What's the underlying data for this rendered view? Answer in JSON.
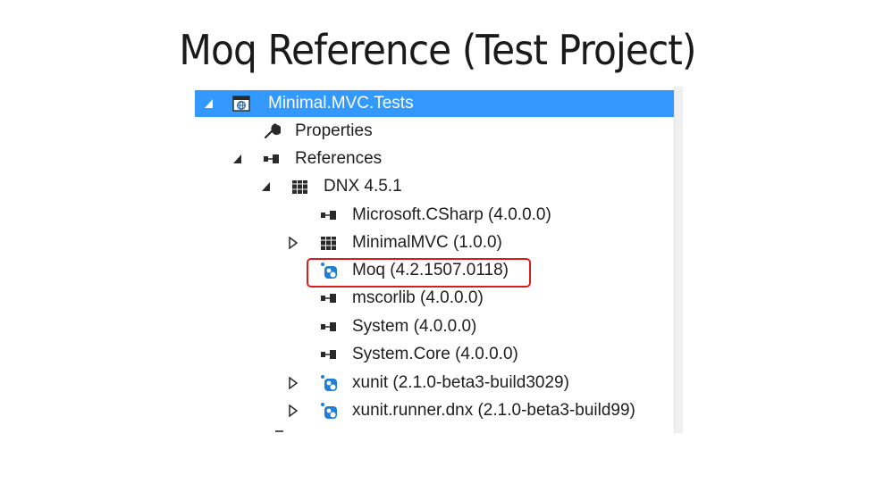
{
  "slide": {
    "title": "Moq Reference (Test Project)"
  },
  "tree": {
    "project": {
      "label": "Minimal.MVC.Tests",
      "expanded": true,
      "selected": true
    },
    "properties": {
      "label": "Properties"
    },
    "references": {
      "label": "References",
      "expanded": true
    },
    "framework": {
      "label": "DNX 4.5.1",
      "expanded": true
    },
    "items": [
      {
        "label": "Microsoft.CSharp (4.0.0.0)",
        "icon": "assembly-reference-icon",
        "expandable": false
      },
      {
        "label": "MinimalMVC (1.0.0)",
        "icon": "project-reference-icon",
        "expandable": true
      },
      {
        "label": "Moq (4.2.1507.0118)",
        "icon": "nuget-package-icon",
        "expandable": false,
        "highlighted": true
      },
      {
        "label": "mscorlib (4.0.0.0)",
        "icon": "assembly-reference-icon",
        "expandable": false
      },
      {
        "label": "System (4.0.0.0)",
        "icon": "assembly-reference-icon",
        "expandable": false
      },
      {
        "label": "System.Core (4.0.0.0)",
        "icon": "assembly-reference-icon",
        "expandable": false
      },
      {
        "label": "xunit (2.1.0-beta3-build3029)",
        "icon": "nuget-package-icon",
        "expandable": true
      },
      {
        "label": "xunit.runner.dnx (2.1.0-beta3-build99)",
        "icon": "nuget-package-icon",
        "expandable": true
      }
    ]
  },
  "colors": {
    "selection": "#3399ff",
    "highlight_border": "#d91c1c",
    "text": "#1e1e1e",
    "package_blue": "#1f7fd6"
  }
}
